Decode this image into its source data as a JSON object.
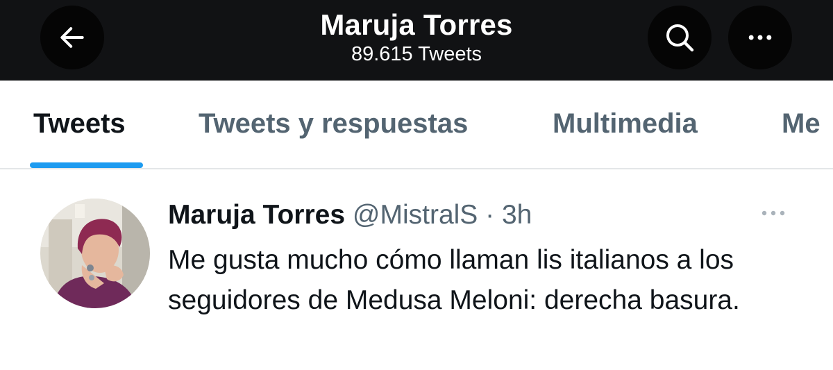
{
  "header": {
    "title": "Maruja Torres",
    "subtitle": "89.615 Tweets",
    "back_icon": "arrow-left-icon",
    "search_icon": "search-icon",
    "more_icon": "more-horizontal-icon"
  },
  "tabs": [
    {
      "label": "Tweets",
      "active": true
    },
    {
      "label": "Tweets y respuestas",
      "active": false
    },
    {
      "label": "Multimedia",
      "active": false
    },
    {
      "label": "Me",
      "active": false
    }
  ],
  "tweet": {
    "author_name": "Maruja Torres",
    "handle": "@MistralS",
    "separator": " · ",
    "time": "3h",
    "text": "Me gusta mucho cómo llaman lis italianos a los seguidores de Medusa Meloni: derecha basura.",
    "more_icon": "more-horizontal-icon"
  },
  "colors": {
    "accent": "#1d9bf0",
    "header_bg": "#111214",
    "primary_text": "#0f1419",
    "secondary_text": "#536471"
  }
}
